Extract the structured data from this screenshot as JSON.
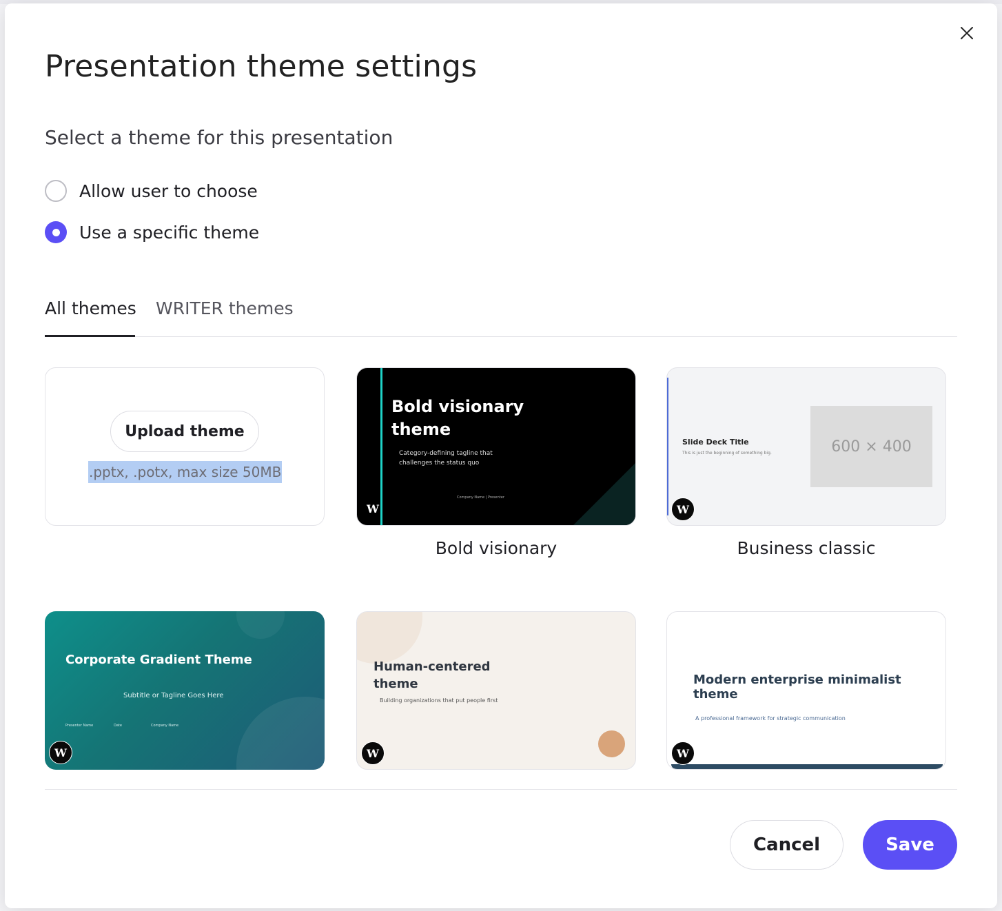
{
  "dialog": {
    "title": "Presentation theme settings",
    "subtitle": "Select a theme for this presentation",
    "close_icon": "close-icon"
  },
  "options": [
    {
      "label": "Allow user to choose",
      "selected": false
    },
    {
      "label": "Use a specific theme",
      "selected": true
    }
  ],
  "tabs": [
    {
      "label": "All themes",
      "active": true
    },
    {
      "label": "WRITER themes",
      "active": false
    }
  ],
  "upload": {
    "button_label": "Upload theme",
    "hint": ".pptx, .potx, max size 50MB"
  },
  "themes": {
    "bold": {
      "caption": "Bold visionary",
      "slide_title": "Bold visionary theme",
      "slide_tagline": "Category-defining tagline that challenges the status quo",
      "slide_footer": "Company Name | Presenter"
    },
    "business": {
      "caption": "Business classic",
      "slide_title": "Slide Deck Title",
      "slide_subtitle": "This is just the beginning of something big.",
      "placeholder": "600 × 400"
    },
    "corporate": {
      "slide_title": "Corporate Gradient Theme",
      "slide_subtitle": "Subtitle or Tagline Goes Here",
      "meta": [
        "Presenter Name",
        "Date",
        "Company Name"
      ]
    },
    "human": {
      "slide_title": "Human-centered theme",
      "slide_subtitle": "Building organizations that put people first"
    },
    "modern": {
      "slide_title": "Modern enterprise minimalist theme",
      "slide_subtitle": "A professional framework for strategic communication"
    },
    "logo_letter": "W"
  },
  "footer": {
    "cancel_label": "Cancel",
    "save_label": "Save"
  },
  "colors": {
    "accent": "#5b4ff5",
    "bold_accent": "#1ed3c8"
  }
}
